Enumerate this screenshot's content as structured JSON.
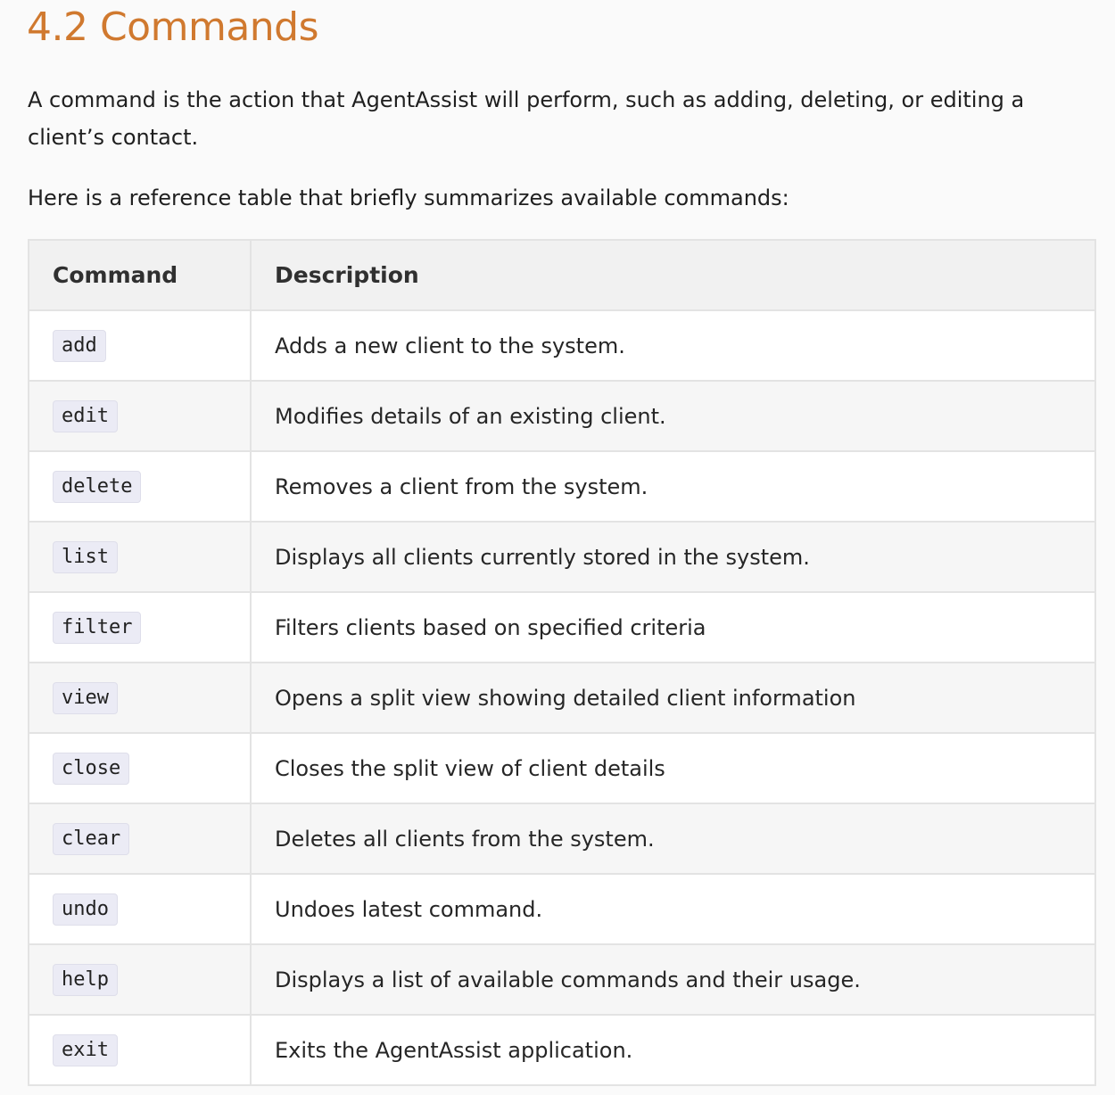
{
  "section": {
    "heading": "4.2 Commands",
    "intro": "A command is the action that AgentAssist will perform, such as adding, deleting, or editing a client’s contact.",
    "table_intro": "Here is a reference table that briefly summarizes available commands:"
  },
  "table": {
    "headers": {
      "command": "Command",
      "description": "Description"
    },
    "rows": [
      {
        "command": "add",
        "description": "Adds a new client to the system."
      },
      {
        "command": "edit",
        "description": "Modifies details of an existing client."
      },
      {
        "command": "delete",
        "description": "Removes a client from the system."
      },
      {
        "command": "list",
        "description": "Displays all clients currently stored in the system."
      },
      {
        "command": "filter",
        "description": "Filters clients based on specified criteria"
      },
      {
        "command": "view",
        "description": "Opens a split view showing detailed client information"
      },
      {
        "command": "close",
        "description": "Closes the split view of client details"
      },
      {
        "command": "clear",
        "description": "Deletes all clients from the system."
      },
      {
        "command": "undo",
        "description": "Undoes latest command."
      },
      {
        "command": "help",
        "description": "Displays a list of available commands and their usage."
      },
      {
        "command": "exit",
        "description": "Exits the AgentAssist application."
      }
    ]
  },
  "colors": {
    "heading": "#d0792f",
    "text": "#1f1f1f",
    "table_header_bg": "#f1f1f1",
    "row_alt_bg": "#f6f6f6",
    "border": "#e3e3e3",
    "code_bg": "#ebebf5"
  }
}
